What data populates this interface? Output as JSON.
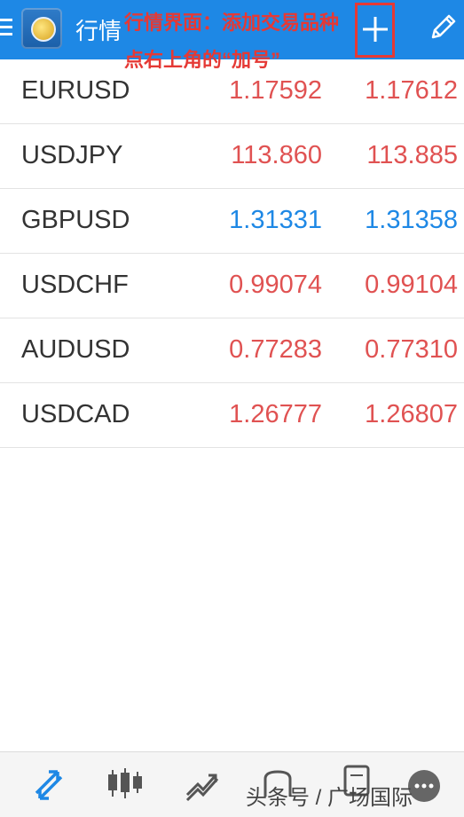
{
  "header": {
    "title": "行情",
    "annotation_line1": "行情界面：添加交易品种",
    "annotation_line2": "点右上角的“加号”",
    "colors": {
      "bar": "#1e88e5",
      "annotation": "#e53935"
    }
  },
  "quotes": [
    {
      "symbol": "EURUSD",
      "bid": "1.17592",
      "ask": "1.17612",
      "color": "#e05252"
    },
    {
      "symbol": "USDJPY",
      "bid": "113.860",
      "ask": "113.885",
      "color": "#e05252"
    },
    {
      "symbol": "GBPUSD",
      "bid": "1.31331",
      "ask": "1.31358",
      "color": "#1e88e5"
    },
    {
      "symbol": "USDCHF",
      "bid": "0.99074",
      "ask": "0.99104",
      "color": "#e05252"
    },
    {
      "symbol": "AUDUSD",
      "bid": "0.77283",
      "ask": "0.77310",
      "color": "#e05252"
    },
    {
      "symbol": "USDCAD",
      "bid": "1.26777",
      "ask": "1.26807",
      "color": "#e05252"
    }
  ],
  "bottom_nav": {
    "items": [
      "quotes-icon",
      "chart-icon",
      "trade-icon",
      "history-icon",
      "messages-icon",
      "more-icon"
    ]
  },
  "watermark": "头条号 / 广场国际"
}
